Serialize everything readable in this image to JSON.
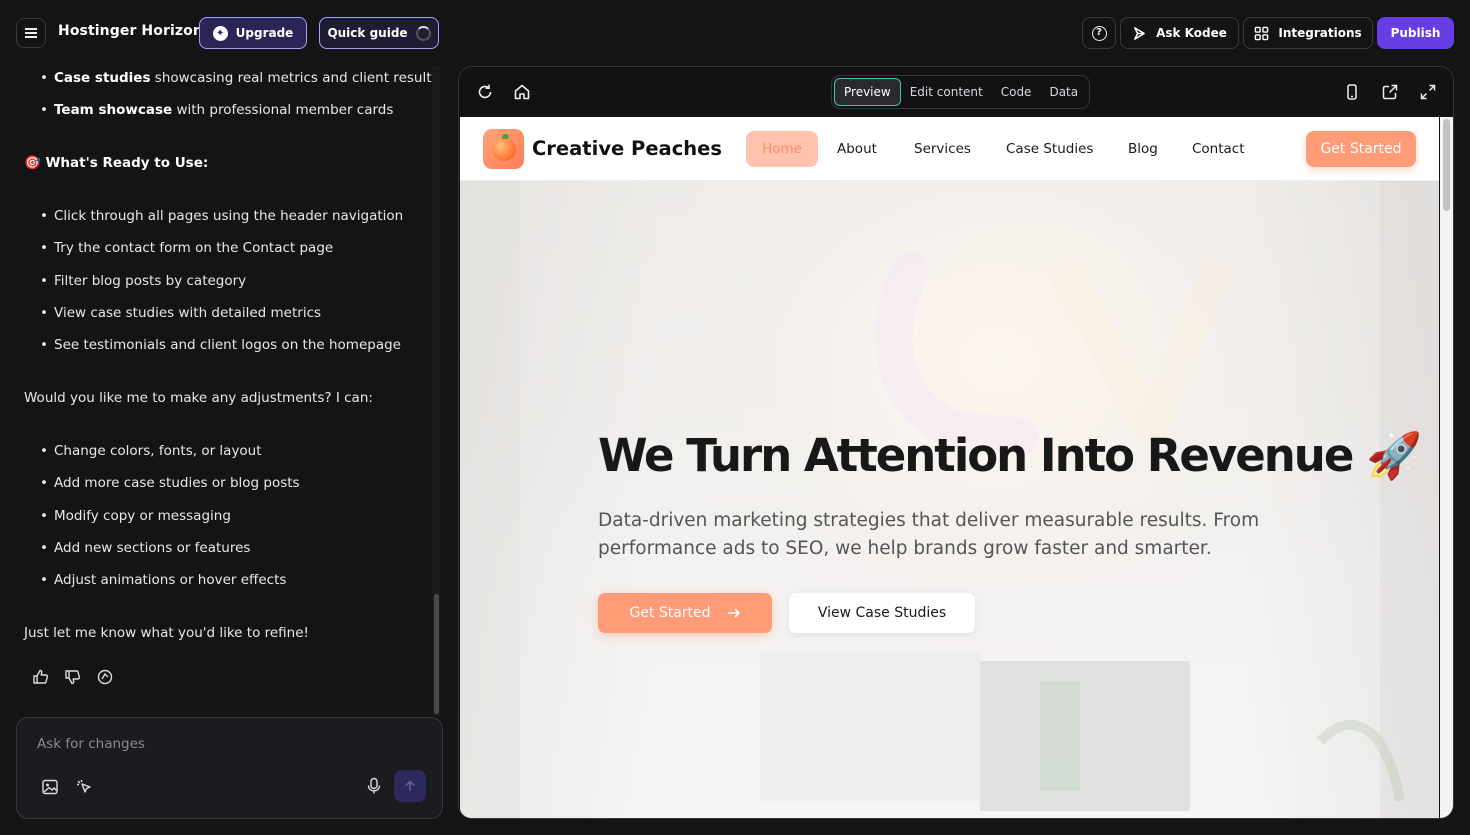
{
  "app": {
    "title": "Hostinger Horizons",
    "upgrade_label": "Upgrade",
    "quick_guide_label": "Quick guide",
    "ask_kodee_label": "Ask Kodee",
    "integrations_label": "Integrations",
    "publish_label": "Publish"
  },
  "chat": {
    "top_bullets": [
      {
        "bold": "Case studies",
        "rest": " showcasing real metrics and client results"
      },
      {
        "bold": "Team showcase",
        "rest": " with professional member cards"
      }
    ],
    "ready_heading": "🎯 What's Ready to Use:",
    "ready_items": [
      "Click through all pages using the header navigation",
      "Try the contact form on the Contact page",
      "Filter blog posts by category",
      "View case studies with detailed metrics",
      "See testimonials and client logos on the homepage"
    ],
    "question": "Would you like me to make any adjustments? I can:",
    "adjust_items": [
      "Change colors, fonts, or layout",
      "Add more case studies or blog posts",
      "Modify copy or messaging",
      "Add new sections or features",
      "Adjust animations or hover effects"
    ],
    "closing": "Just let me know what you'd like to refine!",
    "input_placeholder": "Ask for changes"
  },
  "preview": {
    "tabs": [
      "Preview",
      "Edit content",
      "Code",
      "Data"
    ],
    "active_tab": "Preview"
  },
  "site": {
    "logo_text": "Creative Peaches",
    "nav": [
      "Home",
      "About",
      "Services",
      "Case Studies",
      "Blog",
      "Contact"
    ],
    "nav_cta": "Get Started",
    "hero_title": "We Turn Attention Into Revenue 🚀",
    "hero_subtitle": "Data-driven marketing strategies that deliver measurable results. From performance ads to SEO, we help brands grow faster and smarter.",
    "hero_primary": "Get Started",
    "hero_secondary": "View Case Studies"
  },
  "colors": {
    "accent_purple": "#673de6",
    "peach": "#ff9b76",
    "active_tab_border": "#49c7a0"
  }
}
